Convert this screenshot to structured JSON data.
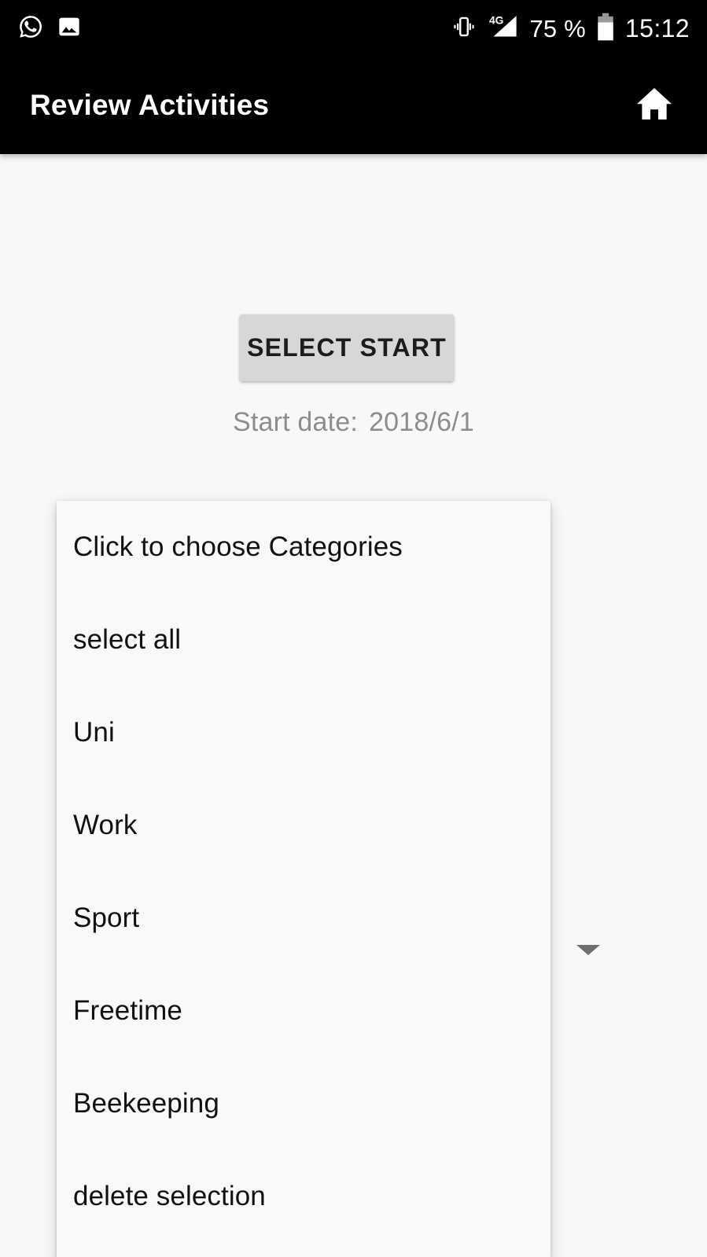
{
  "status_bar": {
    "left_icons": [
      {
        "name": "whatsapp-icon",
        "label": "WhatsApp"
      },
      {
        "name": "image-icon",
        "label": "Gallery"
      }
    ],
    "right_icons": [
      {
        "name": "vibrate-icon",
        "label": "Vibrate"
      },
      {
        "name": "signal-4g-icon",
        "label": "4G"
      },
      {
        "name": "battery-icon",
        "label": "Battery"
      }
    ],
    "network_label": "4G",
    "battery_percent": "75 %",
    "battery_level": 75,
    "time": "15:12",
    "background_color": "#000000",
    "foreground_color": "#ffffff"
  },
  "app_bar": {
    "title": "Review Activities",
    "home_icon": "home-icon",
    "background_color": "#000000",
    "text_color": "#ffffff"
  },
  "main": {
    "background_color": "#f8f8f8",
    "select_start_button": {
      "label": "SELECT START",
      "background_color": "#d6d7d7",
      "text_color": "#1c1c1c"
    },
    "start_date": {
      "label": "Start date:",
      "value": "2018/6/1",
      "text_color": "#8d8d8d"
    },
    "category_spinner": {
      "arrow_icon": "chevron-down-icon",
      "arrow_color": "#6e6e6e",
      "popup_background": "#f9f9f9",
      "items": [
        {
          "label": "Click to choose Categories"
        },
        {
          "label": "select all"
        },
        {
          "label": "Uni"
        },
        {
          "label": "Work"
        },
        {
          "label": "Sport"
        },
        {
          "label": "Freetime"
        },
        {
          "label": "Beekeeping"
        },
        {
          "label": "delete selection"
        }
      ]
    }
  }
}
